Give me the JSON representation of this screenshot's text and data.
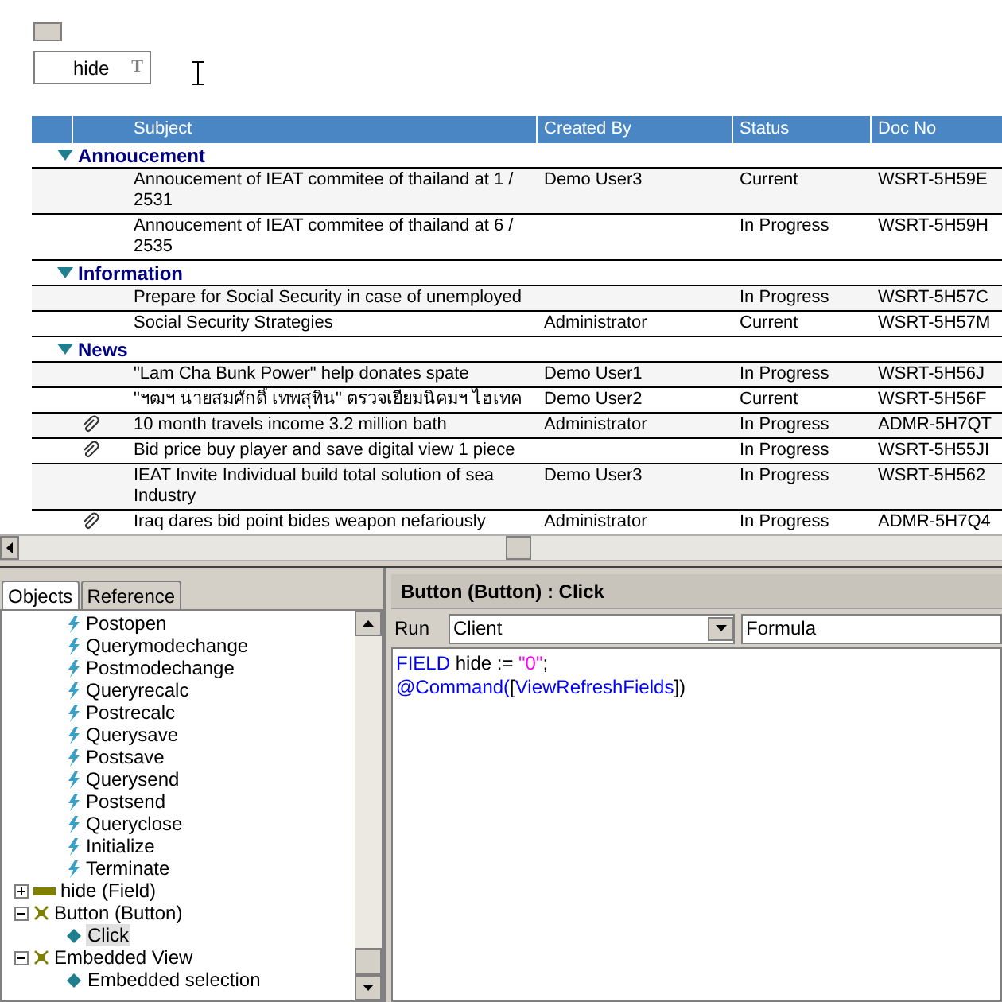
{
  "form": {
    "field_value": "hide",
    "type_marker": "T"
  },
  "view": {
    "columns": [
      "Subject",
      "Created By",
      "Status",
      "Doc No"
    ],
    "categories": [
      {
        "name": "Annoucement",
        "expanded": true,
        "rows": [
          {
            "attachment": false,
            "subject": "Annoucement of IEAT commitee of thailand at 1 / 2531",
            "created_by": "Demo User3",
            "status": "Current",
            "doc_no": "WSRT-5H59E"
          },
          {
            "attachment": false,
            "subject": "Annoucement of IEAT commitee of thailand at 6 / 2535",
            "created_by": "",
            "status": "In Progress",
            "doc_no": "WSRT-5H59H"
          }
        ]
      },
      {
        "name": "Information",
        "expanded": true,
        "rows": [
          {
            "attachment": false,
            "subject": "Prepare for Social Security in case of unemployed",
            "created_by": "",
            "status": "In Progress",
            "doc_no": "WSRT-5H57C"
          },
          {
            "attachment": false,
            "subject": "Social Security Strategies",
            "created_by": "Administrator",
            "status": "Current",
            "doc_no": "WSRT-5H57M"
          }
        ]
      },
      {
        "name": "News",
        "expanded": true,
        "rows": [
          {
            "attachment": false,
            "subject": "\"Lam Cha Bunk Power\" help donates spate",
            "created_by": "Demo User1",
            "status": "In Progress",
            "doc_no": "WSRT-5H56J"
          },
          {
            "attachment": false,
            "subject": "\"ฯฒฯ นายสมศักดิ์ เทพสุทิน\" ตรวจเยี่ยมนิคมฯ ไฮเทค",
            "created_by": "Demo User2",
            "status": "Current",
            "doc_no": "WSRT-5H56F"
          },
          {
            "attachment": true,
            "subject": "10 month travels income 3.2 million bath",
            "created_by": "Administrator",
            "status": "In Progress",
            "doc_no": "ADMR-5H7QT"
          },
          {
            "attachment": true,
            "subject": "Bid price buy player and save digital view 1 piece",
            "created_by": "",
            "status": "In Progress",
            "doc_no": "WSRT-5H55JI"
          },
          {
            "attachment": false,
            "subject": "IEAT Invite Individual build total solution of sea Industry",
            "created_by": "Demo User3",
            "status": "In Progress",
            "doc_no": "WSRT-5H562"
          },
          {
            "attachment": true,
            "subject": "Iraq dares bid point bides weapon nefariously",
            "created_by": "Administrator",
            "status": "In Progress",
            "doc_no": "ADMR-5H7Q4"
          }
        ]
      }
    ]
  },
  "panel_tabs": [
    {
      "label": "Objects",
      "selected": true
    },
    {
      "label": "Reference",
      "selected": false
    }
  ],
  "tree": [
    {
      "kind": "event",
      "label": "Postopen"
    },
    {
      "kind": "event",
      "label": "Querymodechange"
    },
    {
      "kind": "event",
      "label": "Postmodechange"
    },
    {
      "kind": "event",
      "label": "Queryrecalc"
    },
    {
      "kind": "event",
      "label": "Postrecalc"
    },
    {
      "kind": "event",
      "label": "Querysave"
    },
    {
      "kind": "event",
      "label": "Postsave"
    },
    {
      "kind": "event",
      "label": "Querysend"
    },
    {
      "kind": "event",
      "label": "Postsend"
    },
    {
      "kind": "event",
      "label": "Queryclose"
    },
    {
      "kind": "event",
      "label": "Initialize"
    },
    {
      "kind": "event",
      "label": "Terminate"
    },
    {
      "kind": "field",
      "label": "hide (Field)",
      "expanded": false
    },
    {
      "kind": "button",
      "label": "Button (Button)",
      "expanded": true,
      "children": [
        {
          "kind": "action",
          "label": "Click",
          "selected": true
        }
      ]
    },
    {
      "kind": "embedded",
      "label": "Embedded View",
      "expanded": true,
      "children": [
        {
          "kind": "action",
          "label": "Embedded selection",
          "selected": false
        }
      ]
    }
  ],
  "editor": {
    "title": "Button (Button) : Click",
    "run_label": "Run",
    "run_target": "Client",
    "language": "Formula",
    "code": [
      [
        {
          "kind": "keyword",
          "text": "FIELD"
        },
        {
          "kind": "plain",
          "text": " hide := "
        },
        {
          "kind": "string",
          "text": "\"0\""
        },
        {
          "kind": "plain",
          "text": ";"
        }
      ],
      [
        {
          "kind": "keyword",
          "text": "@Command("
        },
        {
          "kind": "plain",
          "text": "["
        },
        {
          "kind": "keyword",
          "text": "ViewRefreshFields"
        },
        {
          "kind": "plain",
          "text": "])"
        }
      ]
    ]
  }
}
